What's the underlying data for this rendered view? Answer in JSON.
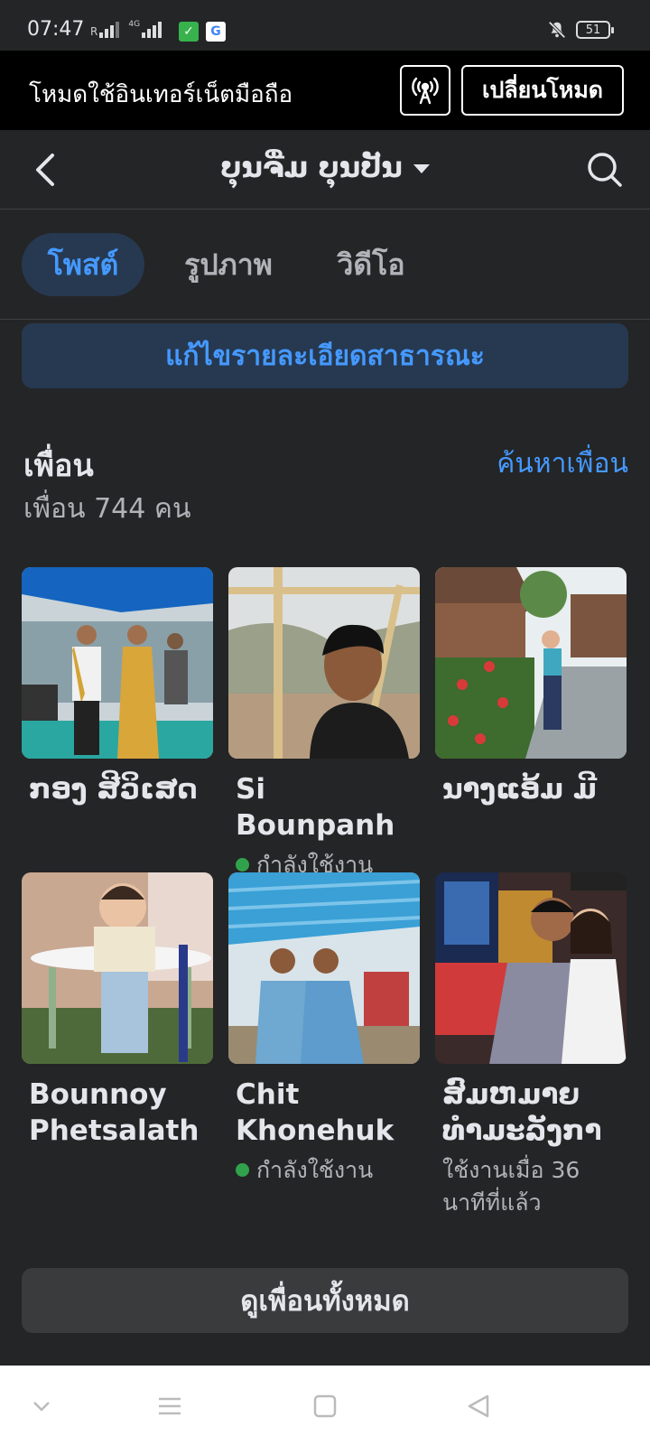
{
  "status_bar": {
    "time": "07:47",
    "roaming_label": "R",
    "network_type": "4G",
    "battery_level": "51"
  },
  "data_banner": {
    "text": "โหมดใช้อินเทอร์เน็ตมือถือ",
    "switch_label": "เปลี่ยนโหมด",
    "icon": "broadcast-tower-icon"
  },
  "header": {
    "profile_name": "ບຸນຈື່ມ ບຸນປັນ"
  },
  "tabs": [
    {
      "label": "โพสต์",
      "active": true
    },
    {
      "label": "รูปภาพ",
      "active": false
    },
    {
      "label": "วิดีโอ",
      "active": false
    }
  ],
  "edit_public_label": "แก้ไขรายละเอียดสาธารณะ",
  "friends": {
    "title": "เพื่อน",
    "find_label": "ค้นหาเพื่อน",
    "count_label": "เพื่อน 744 คน",
    "items": [
      {
        "name": "ກອງ ສີວິເສດ",
        "status": ""
      },
      {
        "name": "Si Bounpanh",
        "status": "กำลังใช้งาน",
        "online": true
      },
      {
        "name": "ນາງແອ້ມ ມີ",
        "status": ""
      },
      {
        "name": "Bounnoy Phetsalath",
        "status": ""
      },
      {
        "name": "Chit Khonehuk",
        "status": "กำลังใช้งาน",
        "online": true
      },
      {
        "name": "ສົມຫມາຍ ທຳມະລັງກາ",
        "status": "ใช้งานเมื่อ 36 นาทีที่แล้ว"
      }
    ],
    "see_all_label": "ดูเพื่อนทั้งหมด"
  },
  "colors": {
    "background": "#242526",
    "accent": "#4599ff",
    "online": "#31a24c"
  }
}
